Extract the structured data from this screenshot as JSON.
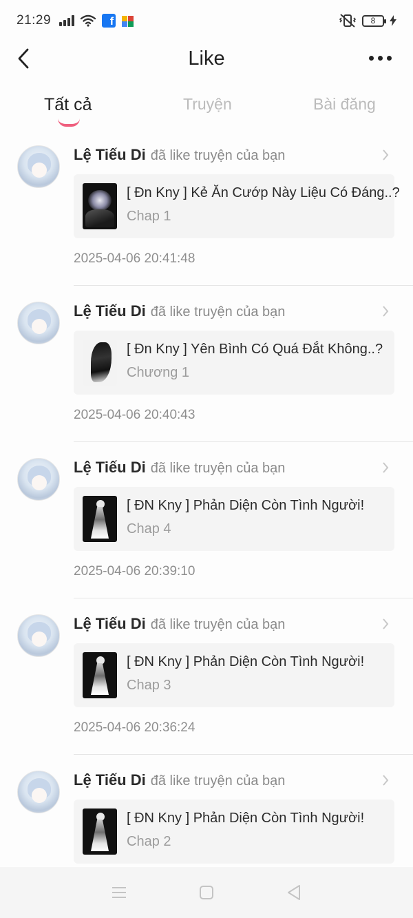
{
  "status_bar": {
    "time": "21:29",
    "battery_level": "8",
    "icons": [
      "signal-icon",
      "wifi-icon",
      "facebook-icon",
      "puzzle-app-icon",
      "vibrate-icon",
      "battery-icon",
      "charging-icon"
    ]
  },
  "header": {
    "title": "Like",
    "back_icon": "back-arrow-icon",
    "more_icon": "more-dots-icon"
  },
  "tabs": [
    {
      "label": "Tất cả",
      "active": true
    },
    {
      "label": "Truyện",
      "active": false
    },
    {
      "label": "Bài đăng",
      "active": false
    }
  ],
  "accent_color": "#ef5f7e",
  "items": [
    {
      "name": "Lệ Tiếu Di",
      "action": "đã like truyện của bạn",
      "story_title": "[ Đn Kny ] Kẻ Ăn Cướp Này Liệu Có Đáng..?",
      "chapter": "Chap 1",
      "timestamp": "2025-04-06 20:41:48"
    },
    {
      "name": "Lệ Tiếu Di",
      "action": "đã like truyện của bạn",
      "story_title": "[ Đn Kny ] Yên Bình Có Quá Đắt Không..?",
      "chapter": "Chương 1",
      "timestamp": "2025-04-06 20:40:43"
    },
    {
      "name": "Lệ Tiếu Di",
      "action": "đã like truyện của bạn",
      "story_title": "[ ĐN Kny ] Phản Diện Còn Tình Người!",
      "chapter": "Chap 4",
      "timestamp": "2025-04-06 20:39:10"
    },
    {
      "name": "Lệ Tiếu Di",
      "action": "đã like truyện của bạn",
      "story_title": "[ ĐN Kny ] Phản Diện Còn Tình Người!",
      "chapter": "Chap 3",
      "timestamp": "2025-04-06 20:36:24"
    },
    {
      "name": "Lệ Tiếu Di",
      "action": "đã like truyện của bạn",
      "story_title": "[ ĐN Kny ] Phản Diện Còn Tình Người!",
      "chapter": "Chap 2",
      "timestamp": ""
    }
  ],
  "nav_bar": {
    "icons": [
      "menu-icon",
      "home-square-icon",
      "back-triangle-icon"
    ]
  }
}
